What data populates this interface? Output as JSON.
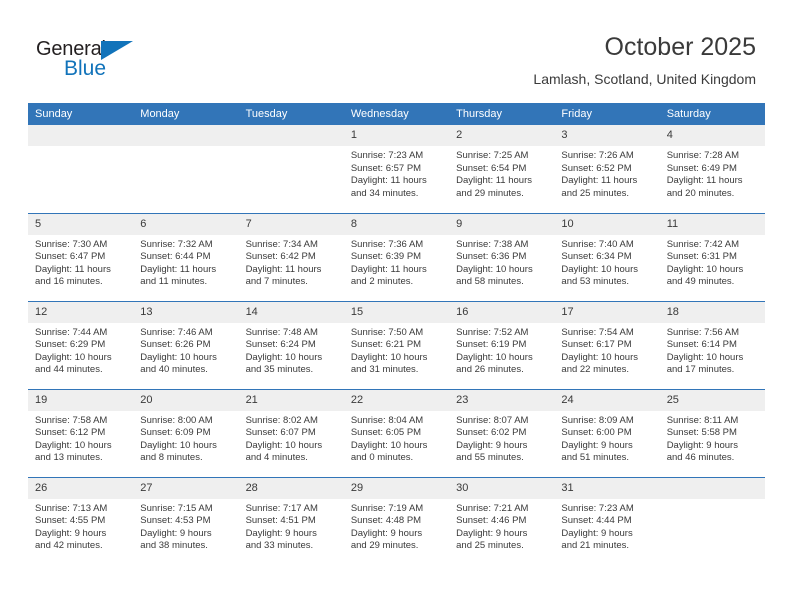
{
  "brand": {
    "name_part1": "General",
    "name_part2": "Blue",
    "triangle_color": "#1173ba"
  },
  "header": {
    "title": "October 2025",
    "subtitle": "Lamlash, Scotland, United Kingdom",
    "accent_color": "#3275b8",
    "daynum_band_color": "#efefef"
  },
  "weekdays": [
    "Sunday",
    "Monday",
    "Tuesday",
    "Wednesday",
    "Thursday",
    "Friday",
    "Saturday"
  ],
  "weeks": [
    [
      {
        "day": "",
        "sunrise": "",
        "sunset": "",
        "daylight1": "",
        "daylight2": ""
      },
      {
        "day": "",
        "sunrise": "",
        "sunset": "",
        "daylight1": "",
        "daylight2": ""
      },
      {
        "day": "",
        "sunrise": "",
        "sunset": "",
        "daylight1": "",
        "daylight2": ""
      },
      {
        "day": "1",
        "sunrise": "Sunrise: 7:23 AM",
        "sunset": "Sunset: 6:57 PM",
        "daylight1": "Daylight: 11 hours",
        "daylight2": "and 34 minutes."
      },
      {
        "day": "2",
        "sunrise": "Sunrise: 7:25 AM",
        "sunset": "Sunset: 6:54 PM",
        "daylight1": "Daylight: 11 hours",
        "daylight2": "and 29 minutes."
      },
      {
        "day": "3",
        "sunrise": "Sunrise: 7:26 AM",
        "sunset": "Sunset: 6:52 PM",
        "daylight1": "Daylight: 11 hours",
        "daylight2": "and 25 minutes."
      },
      {
        "day": "4",
        "sunrise": "Sunrise: 7:28 AM",
        "sunset": "Sunset: 6:49 PM",
        "daylight1": "Daylight: 11 hours",
        "daylight2": "and 20 minutes."
      }
    ],
    [
      {
        "day": "5",
        "sunrise": "Sunrise: 7:30 AM",
        "sunset": "Sunset: 6:47 PM",
        "daylight1": "Daylight: 11 hours",
        "daylight2": "and 16 minutes."
      },
      {
        "day": "6",
        "sunrise": "Sunrise: 7:32 AM",
        "sunset": "Sunset: 6:44 PM",
        "daylight1": "Daylight: 11 hours",
        "daylight2": "and 11 minutes."
      },
      {
        "day": "7",
        "sunrise": "Sunrise: 7:34 AM",
        "sunset": "Sunset: 6:42 PM",
        "daylight1": "Daylight: 11 hours",
        "daylight2": "and 7 minutes."
      },
      {
        "day": "8",
        "sunrise": "Sunrise: 7:36 AM",
        "sunset": "Sunset: 6:39 PM",
        "daylight1": "Daylight: 11 hours",
        "daylight2": "and 2 minutes."
      },
      {
        "day": "9",
        "sunrise": "Sunrise: 7:38 AM",
        "sunset": "Sunset: 6:36 PM",
        "daylight1": "Daylight: 10 hours",
        "daylight2": "and 58 minutes."
      },
      {
        "day": "10",
        "sunrise": "Sunrise: 7:40 AM",
        "sunset": "Sunset: 6:34 PM",
        "daylight1": "Daylight: 10 hours",
        "daylight2": "and 53 minutes."
      },
      {
        "day": "11",
        "sunrise": "Sunrise: 7:42 AM",
        "sunset": "Sunset: 6:31 PM",
        "daylight1": "Daylight: 10 hours",
        "daylight2": "and 49 minutes."
      }
    ],
    [
      {
        "day": "12",
        "sunrise": "Sunrise: 7:44 AM",
        "sunset": "Sunset: 6:29 PM",
        "daylight1": "Daylight: 10 hours",
        "daylight2": "and 44 minutes."
      },
      {
        "day": "13",
        "sunrise": "Sunrise: 7:46 AM",
        "sunset": "Sunset: 6:26 PM",
        "daylight1": "Daylight: 10 hours",
        "daylight2": "and 40 minutes."
      },
      {
        "day": "14",
        "sunrise": "Sunrise: 7:48 AM",
        "sunset": "Sunset: 6:24 PM",
        "daylight1": "Daylight: 10 hours",
        "daylight2": "and 35 minutes."
      },
      {
        "day": "15",
        "sunrise": "Sunrise: 7:50 AM",
        "sunset": "Sunset: 6:21 PM",
        "daylight1": "Daylight: 10 hours",
        "daylight2": "and 31 minutes."
      },
      {
        "day": "16",
        "sunrise": "Sunrise: 7:52 AM",
        "sunset": "Sunset: 6:19 PM",
        "daylight1": "Daylight: 10 hours",
        "daylight2": "and 26 minutes."
      },
      {
        "day": "17",
        "sunrise": "Sunrise: 7:54 AM",
        "sunset": "Sunset: 6:17 PM",
        "daylight1": "Daylight: 10 hours",
        "daylight2": "and 22 minutes."
      },
      {
        "day": "18",
        "sunrise": "Sunrise: 7:56 AM",
        "sunset": "Sunset: 6:14 PM",
        "daylight1": "Daylight: 10 hours",
        "daylight2": "and 17 minutes."
      }
    ],
    [
      {
        "day": "19",
        "sunrise": "Sunrise: 7:58 AM",
        "sunset": "Sunset: 6:12 PM",
        "daylight1": "Daylight: 10 hours",
        "daylight2": "and 13 minutes."
      },
      {
        "day": "20",
        "sunrise": "Sunrise: 8:00 AM",
        "sunset": "Sunset: 6:09 PM",
        "daylight1": "Daylight: 10 hours",
        "daylight2": "and 8 minutes."
      },
      {
        "day": "21",
        "sunrise": "Sunrise: 8:02 AM",
        "sunset": "Sunset: 6:07 PM",
        "daylight1": "Daylight: 10 hours",
        "daylight2": "and 4 minutes."
      },
      {
        "day": "22",
        "sunrise": "Sunrise: 8:04 AM",
        "sunset": "Sunset: 6:05 PM",
        "daylight1": "Daylight: 10 hours",
        "daylight2": "and 0 minutes."
      },
      {
        "day": "23",
        "sunrise": "Sunrise: 8:07 AM",
        "sunset": "Sunset: 6:02 PM",
        "daylight1": "Daylight: 9 hours",
        "daylight2": "and 55 minutes."
      },
      {
        "day": "24",
        "sunrise": "Sunrise: 8:09 AM",
        "sunset": "Sunset: 6:00 PM",
        "daylight1": "Daylight: 9 hours",
        "daylight2": "and 51 minutes."
      },
      {
        "day": "25",
        "sunrise": "Sunrise: 8:11 AM",
        "sunset": "Sunset: 5:58 PM",
        "daylight1": "Daylight: 9 hours",
        "daylight2": "and 46 minutes."
      }
    ],
    [
      {
        "day": "26",
        "sunrise": "Sunrise: 7:13 AM",
        "sunset": "Sunset: 4:55 PM",
        "daylight1": "Daylight: 9 hours",
        "daylight2": "and 42 minutes."
      },
      {
        "day": "27",
        "sunrise": "Sunrise: 7:15 AM",
        "sunset": "Sunset: 4:53 PM",
        "daylight1": "Daylight: 9 hours",
        "daylight2": "and 38 minutes."
      },
      {
        "day": "28",
        "sunrise": "Sunrise: 7:17 AM",
        "sunset": "Sunset: 4:51 PM",
        "daylight1": "Daylight: 9 hours",
        "daylight2": "and 33 minutes."
      },
      {
        "day": "29",
        "sunrise": "Sunrise: 7:19 AM",
        "sunset": "Sunset: 4:48 PM",
        "daylight1": "Daylight: 9 hours",
        "daylight2": "and 29 minutes."
      },
      {
        "day": "30",
        "sunrise": "Sunrise: 7:21 AM",
        "sunset": "Sunset: 4:46 PM",
        "daylight1": "Daylight: 9 hours",
        "daylight2": "and 25 minutes."
      },
      {
        "day": "31",
        "sunrise": "Sunrise: 7:23 AM",
        "sunset": "Sunset: 4:44 PM",
        "daylight1": "Daylight: 9 hours",
        "daylight2": "and 21 minutes."
      },
      {
        "day": "",
        "sunrise": "",
        "sunset": "",
        "daylight1": "",
        "daylight2": ""
      }
    ]
  ]
}
